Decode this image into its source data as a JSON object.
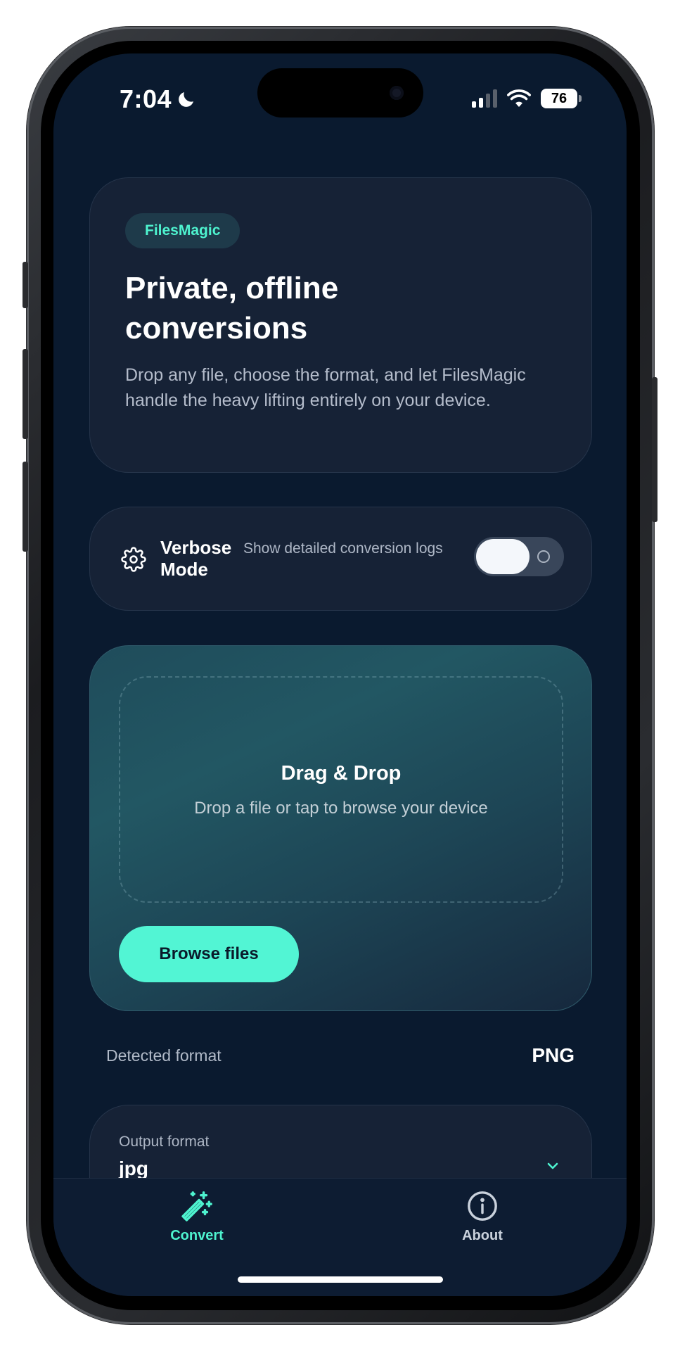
{
  "status_bar": {
    "time": "7:04",
    "battery": "76"
  },
  "hero": {
    "badge": "FilesMagic",
    "title": "Private, offline conversions",
    "description": "Drop any file, choose the format, and let FilesMagic handle the heavy lifting entirely on your device."
  },
  "verbose": {
    "title": "Verbose Mode",
    "description": "Show detailed conversion logs",
    "enabled": false
  },
  "dropzone": {
    "title": "Drag & Drop",
    "description": "Drop a file or tap to browse your device",
    "button_label": "Browse files"
  },
  "detected": {
    "label": "Detected format",
    "value": "PNG"
  },
  "output": {
    "label": "Output format",
    "value": "jpg"
  },
  "tabs": [
    {
      "label": "Convert",
      "icon": "magic-wand-icon",
      "active": true
    },
    {
      "label": "About",
      "icon": "info-icon",
      "active": false
    }
  ],
  "colors": {
    "accent": "#52f5d4",
    "background": "#0a1a2f",
    "card": "#162236"
  }
}
